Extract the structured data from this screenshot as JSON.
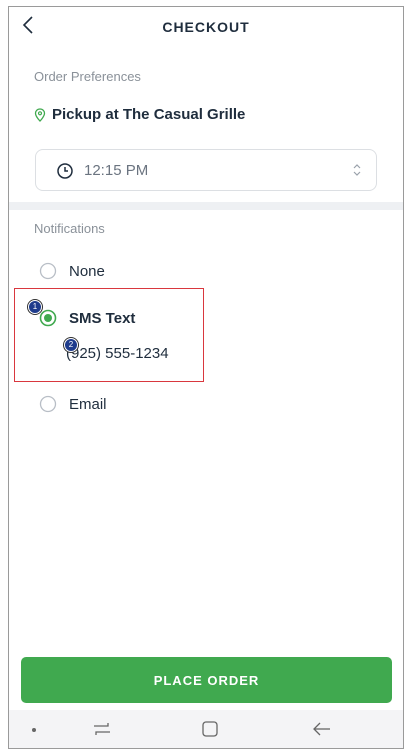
{
  "header": {
    "title": "CHECKOUT",
    "back_icon": "chevron-left-icon"
  },
  "order_preferences": {
    "label": "Order Preferences",
    "pickup_label": "Pickup at The Casual Grille",
    "pickup_icon": "location-pin-icon",
    "time_value": "12:15 PM"
  },
  "notifications": {
    "label": "Notifications",
    "options": [
      {
        "label": "None",
        "selected": false
      },
      {
        "label": "SMS Text",
        "selected": true
      },
      {
        "label": "Email",
        "selected": false
      }
    ],
    "phone": "(925) 555-1234"
  },
  "annotations": {
    "marker_1": "1",
    "marker_2": "2"
  },
  "footer": {
    "place_order_label": "PLACE ORDER"
  },
  "colors": {
    "accent": "#40a94f",
    "text": "#1f2d3d",
    "muted": "#8a9199",
    "highlight": "#d9373e"
  }
}
